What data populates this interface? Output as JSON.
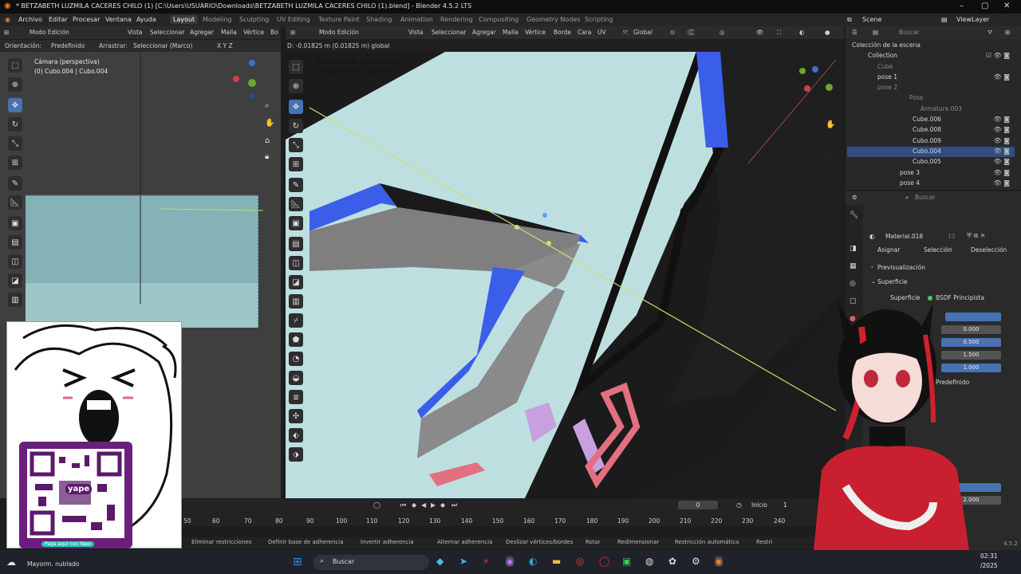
{
  "window": {
    "title": "* BETZABETH LUZMILA CACERES CHILO (1) [C:\\Users\\USUARIO\\Downloads\\BETZABETH LUZMILA CACERES CHILO (1).blend] - Blender 4.5.2 LTS"
  },
  "menu": [
    "Archivo",
    "Editar",
    "Procesar",
    "Ventana",
    "Ayuda"
  ],
  "workspaces": [
    "Layout",
    "Modeling",
    "Sculpting",
    "UV Editing",
    "Texture Paint",
    "Shading",
    "Animation",
    "Rendering",
    "Compositing",
    "Geometry Nodes",
    "Scripting"
  ],
  "scene": {
    "name": "Scene",
    "view_layer": "ViewLayer"
  },
  "left_viewport": {
    "mode": "Modo Edición",
    "menus": [
      "Vista",
      "Seleccionar",
      "Agregar",
      "Malla",
      "Vértice",
      "Bo"
    ],
    "orientation_label": "Orientación:",
    "orientation_value": "Predefinido",
    "drag_label": "Arrastrar:",
    "drag_value": "Seleccionar (Marco)",
    "axes": "X  Y  Z",
    "overlay_line1": "Cámara (perspectiva)",
    "overlay_line2": "(0) Cubo.004 | Cubo.004"
  },
  "right_viewport": {
    "mode": "Modo Edición",
    "menus": [
      "Vista",
      "Seleccionar",
      "Agregar",
      "Malla",
      "Vértice",
      "Borde",
      "Cara",
      "UV"
    ],
    "transform": "Global",
    "status_text": "D: -0.01825 m (0.01825 m) global",
    "overlay_line1": "Personalizada (perspectiva)",
    "overlay_line2": "(0) Cubo.004 | Cubo.004"
  },
  "outliner": {
    "search_placeholder": "Buscar",
    "items": [
      {
        "label": "Colección de la escena",
        "indent": 0
      },
      {
        "label": "Collection",
        "indent": 1
      },
      {
        "label": "Cube",
        "indent": 2
      },
      {
        "label": "pose 1",
        "indent": 2
      },
      {
        "label": "pose 2",
        "indent": 2
      },
      {
        "label": "Pose",
        "indent": 3
      },
      {
        "label": "Armature.003",
        "indent": 3
      },
      {
        "label": "Cube.006",
        "indent": 3
      },
      {
        "label": "Cube.008",
        "indent": 3
      },
      {
        "label": "Cubo.009",
        "indent": 3
      },
      {
        "label": "Cubo.004",
        "indent": 3,
        "selected": true
      },
      {
        "label": "Cubo.005",
        "indent": 3
      },
      {
        "label": "pose 3",
        "indent": 2
      },
      {
        "label": "pose 4",
        "indent": 2
      }
    ]
  },
  "properties": {
    "search_placeholder": "Buscar",
    "material_name": "Material.018",
    "material_users": "10",
    "assign": "Asignar",
    "select": "Selección",
    "deselect": "Deselección",
    "preview": "Previsualización",
    "surface_section": "Superficie",
    "surface_label": "Superficie",
    "surface_value": "BSDF Principista",
    "values": [
      "0.000",
      "0.500",
      "1.500",
      "1.000"
    ],
    "predefined": "Predefinido",
    "bottom_value": "2.000"
  },
  "timeline": {
    "current_frame": "0",
    "start_label": "Inicio",
    "start_value": "1",
    "ticks": [
      "50",
      "60",
      "70",
      "80",
      "90",
      "100",
      "110",
      "120",
      "130",
      "140",
      "150",
      "160",
      "170",
      "180",
      "190",
      "200",
      "210",
      "220",
      "230",
      "240"
    ]
  },
  "statusbar": [
    "Eliminar restricciones",
    "Definir base de adherencia",
    "Invertir adherencia",
    "Alternar adherencia",
    "Deslizar vértices/bordes",
    "Rotar",
    "Redimensionar",
    "Restricción automática",
    "Restri"
  ],
  "version": "4.5.2",
  "overlay_image": {
    "qr_caption": "Paga aquí con Yape",
    "brand": "yape"
  },
  "taskbar": {
    "weather": "Mayorm. nublado",
    "search": "Buscar",
    "time": "02:31",
    "date": "/2025"
  },
  "colors": {
    "accent": "#4772b3",
    "viewport_bg": "#b9dcdc",
    "mesh_blue": "#3a5ee8",
    "header_bg": "#2b2b2b"
  }
}
